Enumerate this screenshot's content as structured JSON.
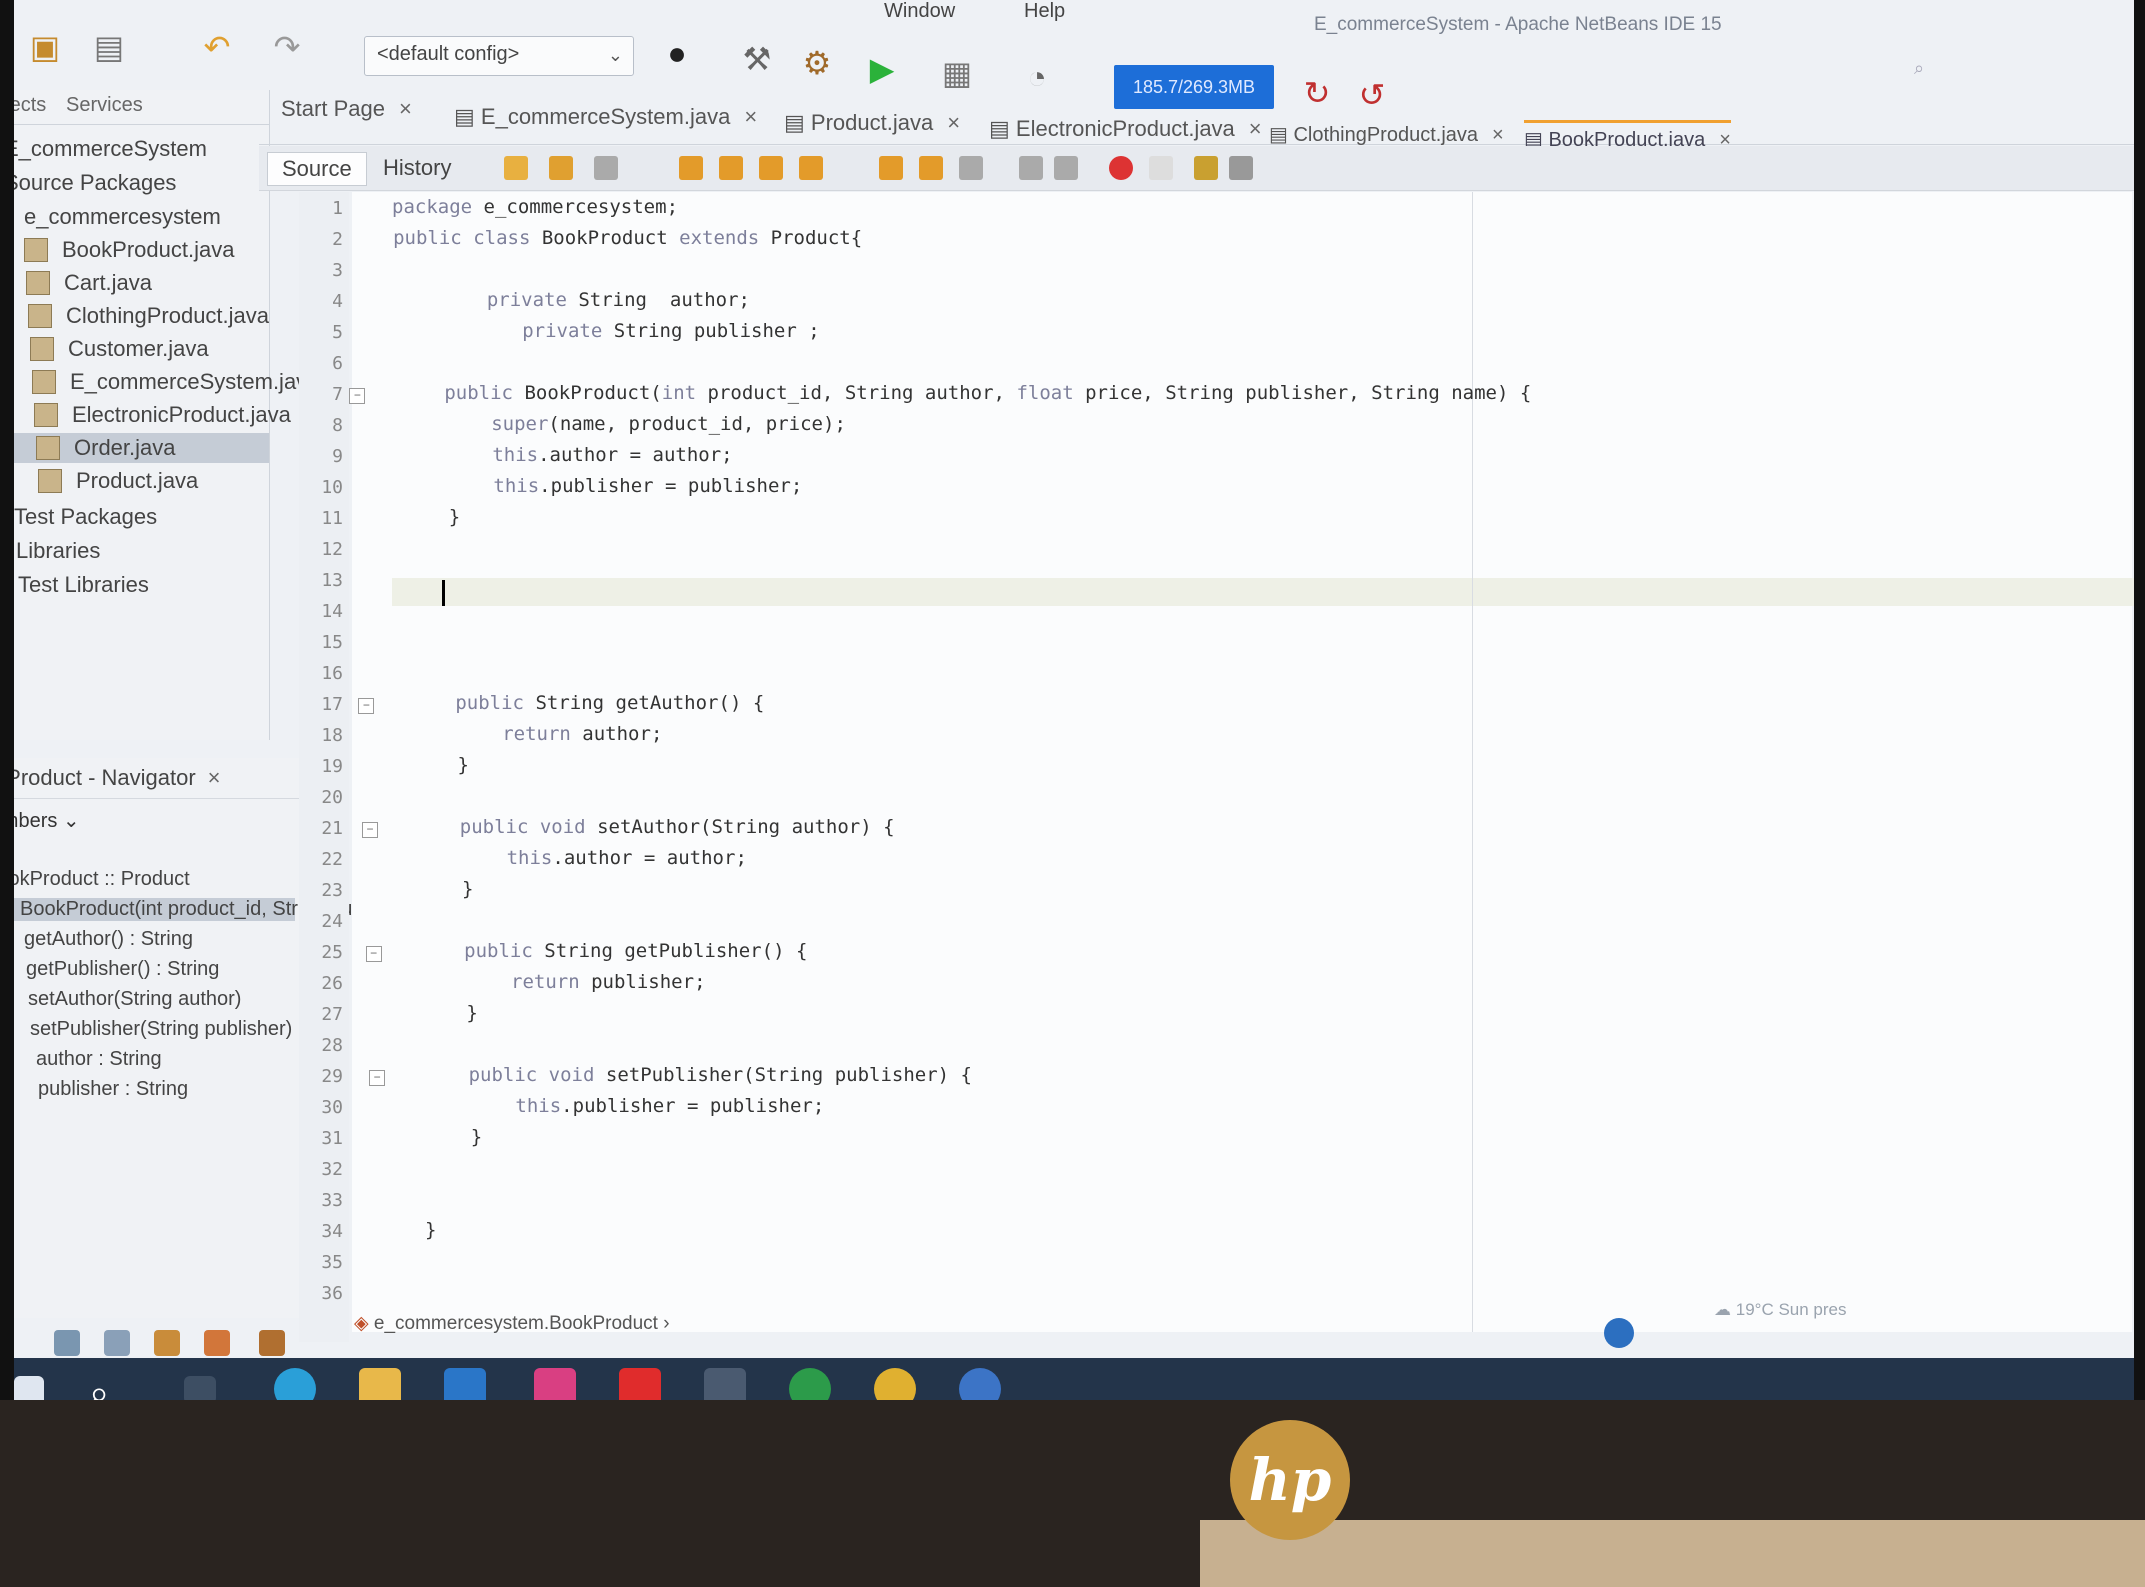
{
  "menu": {
    "items": [
      "Window",
      "Help"
    ]
  },
  "window_title": "E_commerceSystem - Apache NetBeans IDE 15",
  "toolbar": {
    "config": "<default config>",
    "memory_label": "185.7/269.3MB"
  },
  "projects_panel": {
    "tabs": [
      "Projects",
      "Services"
    ],
    "tree": [
      {
        "label": "E_commerceSystem",
        "level": 0
      },
      {
        "label": "Source Packages",
        "level": 0
      },
      {
        "label": "e_commercesystem",
        "level": 1
      },
      {
        "label": "BookProduct.java",
        "level": 2
      },
      {
        "label": "Cart.java",
        "level": 2
      },
      {
        "label": "ClothingProduct.java",
        "level": 2
      },
      {
        "label": "Customer.java",
        "level": 2
      },
      {
        "label": "E_commerceSystem.java",
        "level": 2
      },
      {
        "label": "ElectronicProduct.java",
        "level": 2
      },
      {
        "label": "Order.java",
        "level": 2,
        "selected": true
      },
      {
        "label": "Product.java",
        "level": 2
      },
      {
        "label": "Test Packages",
        "level": 0
      },
      {
        "label": "Libraries",
        "level": 0
      },
      {
        "label": "Test Libraries",
        "level": 0
      }
    ]
  },
  "navigator": {
    "title": "BookProduct - Navigator",
    "filter": "Members",
    "class_row": "BookProduct :: Product",
    "members": [
      "BookProduct(int product_id, String author, float price, String publisher, String name)",
      "getAuthor() : String",
      "getPublisher() : String",
      "setAuthor(String author)",
      "setPublisher(String publisher)",
      "author : String",
      "publisher : String"
    ]
  },
  "editor": {
    "tabs": [
      {
        "label": "Start Page"
      },
      {
        "label": "E_commerceSystem.java"
      },
      {
        "label": "Product.java"
      },
      {
        "label": "ElectronicProduct.java"
      },
      {
        "label": "ClothingProduct.java"
      },
      {
        "label": "BookProduct.java",
        "active": true
      }
    ],
    "source_tab": "Source",
    "history_tab": "History",
    "lines": [
      "package e_commercesystem;",
      "public class BookProduct extends Product{",
      "",
      "        private String  author;",
      "           private String publisher ;",
      "",
      "    public BookProduct(int product_id, String author, float price, String publisher, String name) {",
      "        super(name, product_id, price);",
      "        this.author = author;",
      "        this.publisher = publisher;",
      "    }",
      "",
      "",
      "",
      "",
      "",
      "    public String getAuthor() {",
      "        return author;",
      "    }",
      "",
      "    public void setAuthor(String author) {",
      "        this.author = author;",
      "    }",
      "",
      "    public String getPublisher() {",
      "        return publisher;",
      "    }",
      "",
      "    public void setPublisher(String publisher) {",
      "        this.publisher = publisher;",
      "    }",
      "",
      "",
      "}",
      "",
      ""
    ],
    "breadcrumb": "e_commercesystem.BookProduct"
  },
  "status": {
    "weather": "19°C Sun pres"
  },
  "brand": {
    "logo": "hp"
  },
  "colors": {
    "keyword": "#7d7f9a",
    "field": "#5a9a5a",
    "memory_bar": "#1d6ed8",
    "logo": "#c69640"
  },
  "icons": [
    "undo-icon",
    "redo-icon",
    "globe-icon",
    "hammer-icon",
    "clean-build-icon",
    "run-icon",
    "debug-icon",
    "profile-icon"
  ]
}
